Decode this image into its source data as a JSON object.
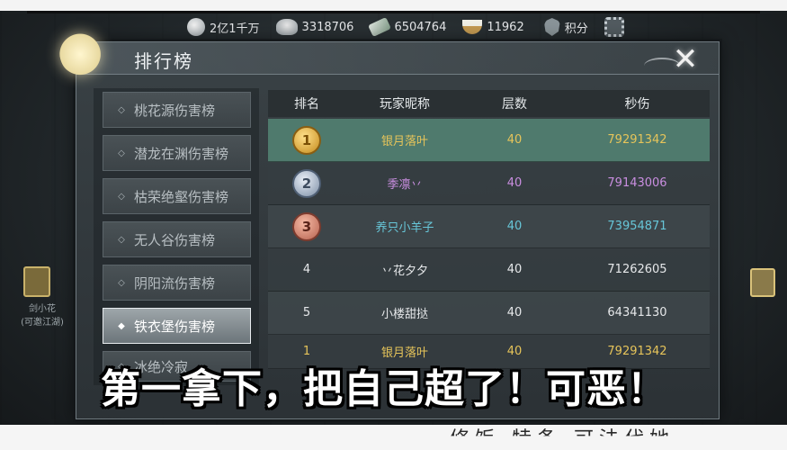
{
  "currency": [
    {
      "icon": "jade-icon",
      "value": "2亿1千万"
    },
    {
      "icon": "ingot-icon",
      "value": "3318706"
    },
    {
      "icon": "scroll-icon",
      "value": "6504764"
    },
    {
      "icon": "bowl-icon",
      "value": "11962"
    }
  ],
  "score_label": "积分",
  "panel": {
    "title": "排行榜",
    "close_symbol": "✕"
  },
  "side_nav": {
    "items": [
      {
        "label": "桃花源伤害榜",
        "active": false
      },
      {
        "label": "潜龙在渊伤害榜",
        "active": false
      },
      {
        "label": "枯荣绝壑伤害榜",
        "active": false
      },
      {
        "label": "无人谷伤害榜",
        "active": false
      },
      {
        "label": "阴阳流伤害榜",
        "active": false
      },
      {
        "label": "铁衣堡伤害榜",
        "active": true
      },
      {
        "label": "冰绝冷寂",
        "active": false
      }
    ]
  },
  "table": {
    "headers": [
      "排名",
      "玩家昵称",
      "层数",
      "秒伤"
    ],
    "rows": [
      {
        "rank": "1",
        "name": "银月落叶",
        "floor": "40",
        "dps": "79291342",
        "medal": "gold"
      },
      {
        "rank": "2",
        "name": "季凛丷",
        "floor": "40",
        "dps": "79143006",
        "medal": "silver"
      },
      {
        "rank": "3",
        "name": "养只小羊子",
        "floor": "40",
        "dps": "73954871",
        "medal": "bronze"
      },
      {
        "rank": "4",
        "name": "丷花夕夕",
        "floor": "40",
        "dps": "71262605",
        "medal": ""
      },
      {
        "rank": "5",
        "name": "小楼甜挞",
        "floor": "40",
        "dps": "64341130",
        "medal": ""
      },
      {
        "rank": "1",
        "name": "银月落叶",
        "floor": "40",
        "dps": "79291342",
        "medal": ""
      }
    ]
  },
  "left_side": {
    "name": "剑小花",
    "sub": "(可邀江湖)"
  },
  "subtitle": "第一拿下，把自己超了！可恶！",
  "bottom_ghost": "修饭 特条 可法代她",
  "colors": {
    "highlight_row": "#4f7a6d",
    "gold_text": "#e6c45a",
    "purple_text": "#c98ee0",
    "cyan_text": "#67c6d8"
  }
}
